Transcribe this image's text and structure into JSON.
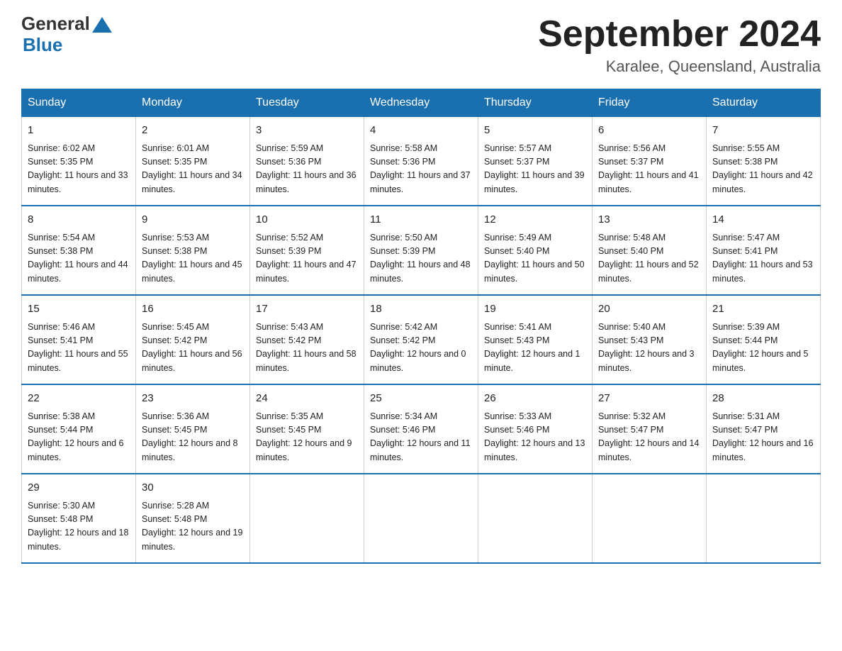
{
  "logo": {
    "general": "General",
    "blue": "Blue"
  },
  "title": "September 2024",
  "subtitle": "Karalee, Queensland, Australia",
  "days_of_week": [
    "Sunday",
    "Monday",
    "Tuesday",
    "Wednesday",
    "Thursday",
    "Friday",
    "Saturday"
  ],
  "weeks": [
    [
      {
        "day": "1",
        "sunrise": "6:02 AM",
        "sunset": "5:35 PM",
        "daylight": "11 hours and 33 minutes."
      },
      {
        "day": "2",
        "sunrise": "6:01 AM",
        "sunset": "5:35 PM",
        "daylight": "11 hours and 34 minutes."
      },
      {
        "day": "3",
        "sunrise": "5:59 AM",
        "sunset": "5:36 PM",
        "daylight": "11 hours and 36 minutes."
      },
      {
        "day": "4",
        "sunrise": "5:58 AM",
        "sunset": "5:36 PM",
        "daylight": "11 hours and 37 minutes."
      },
      {
        "day": "5",
        "sunrise": "5:57 AM",
        "sunset": "5:37 PM",
        "daylight": "11 hours and 39 minutes."
      },
      {
        "day": "6",
        "sunrise": "5:56 AM",
        "sunset": "5:37 PM",
        "daylight": "11 hours and 41 minutes."
      },
      {
        "day": "7",
        "sunrise": "5:55 AM",
        "sunset": "5:38 PM",
        "daylight": "11 hours and 42 minutes."
      }
    ],
    [
      {
        "day": "8",
        "sunrise": "5:54 AM",
        "sunset": "5:38 PM",
        "daylight": "11 hours and 44 minutes."
      },
      {
        "day": "9",
        "sunrise": "5:53 AM",
        "sunset": "5:38 PM",
        "daylight": "11 hours and 45 minutes."
      },
      {
        "day": "10",
        "sunrise": "5:52 AM",
        "sunset": "5:39 PM",
        "daylight": "11 hours and 47 minutes."
      },
      {
        "day": "11",
        "sunrise": "5:50 AM",
        "sunset": "5:39 PM",
        "daylight": "11 hours and 48 minutes."
      },
      {
        "day": "12",
        "sunrise": "5:49 AM",
        "sunset": "5:40 PM",
        "daylight": "11 hours and 50 minutes."
      },
      {
        "day": "13",
        "sunrise": "5:48 AM",
        "sunset": "5:40 PM",
        "daylight": "11 hours and 52 minutes."
      },
      {
        "day": "14",
        "sunrise": "5:47 AM",
        "sunset": "5:41 PM",
        "daylight": "11 hours and 53 minutes."
      }
    ],
    [
      {
        "day": "15",
        "sunrise": "5:46 AM",
        "sunset": "5:41 PM",
        "daylight": "11 hours and 55 minutes."
      },
      {
        "day": "16",
        "sunrise": "5:45 AM",
        "sunset": "5:42 PM",
        "daylight": "11 hours and 56 minutes."
      },
      {
        "day": "17",
        "sunrise": "5:43 AM",
        "sunset": "5:42 PM",
        "daylight": "11 hours and 58 minutes."
      },
      {
        "day": "18",
        "sunrise": "5:42 AM",
        "sunset": "5:42 PM",
        "daylight": "12 hours and 0 minutes."
      },
      {
        "day": "19",
        "sunrise": "5:41 AM",
        "sunset": "5:43 PM",
        "daylight": "12 hours and 1 minute."
      },
      {
        "day": "20",
        "sunrise": "5:40 AM",
        "sunset": "5:43 PM",
        "daylight": "12 hours and 3 minutes."
      },
      {
        "day": "21",
        "sunrise": "5:39 AM",
        "sunset": "5:44 PM",
        "daylight": "12 hours and 5 minutes."
      }
    ],
    [
      {
        "day": "22",
        "sunrise": "5:38 AM",
        "sunset": "5:44 PM",
        "daylight": "12 hours and 6 minutes."
      },
      {
        "day": "23",
        "sunrise": "5:36 AM",
        "sunset": "5:45 PM",
        "daylight": "12 hours and 8 minutes."
      },
      {
        "day": "24",
        "sunrise": "5:35 AM",
        "sunset": "5:45 PM",
        "daylight": "12 hours and 9 minutes."
      },
      {
        "day": "25",
        "sunrise": "5:34 AM",
        "sunset": "5:46 PM",
        "daylight": "12 hours and 11 minutes."
      },
      {
        "day": "26",
        "sunrise": "5:33 AM",
        "sunset": "5:46 PM",
        "daylight": "12 hours and 13 minutes."
      },
      {
        "day": "27",
        "sunrise": "5:32 AM",
        "sunset": "5:47 PM",
        "daylight": "12 hours and 14 minutes."
      },
      {
        "day": "28",
        "sunrise": "5:31 AM",
        "sunset": "5:47 PM",
        "daylight": "12 hours and 16 minutes."
      }
    ],
    [
      {
        "day": "29",
        "sunrise": "5:30 AM",
        "sunset": "5:48 PM",
        "daylight": "12 hours and 18 minutes."
      },
      {
        "day": "30",
        "sunrise": "5:28 AM",
        "sunset": "5:48 PM",
        "daylight": "12 hours and 19 minutes."
      },
      null,
      null,
      null,
      null,
      null
    ]
  ]
}
